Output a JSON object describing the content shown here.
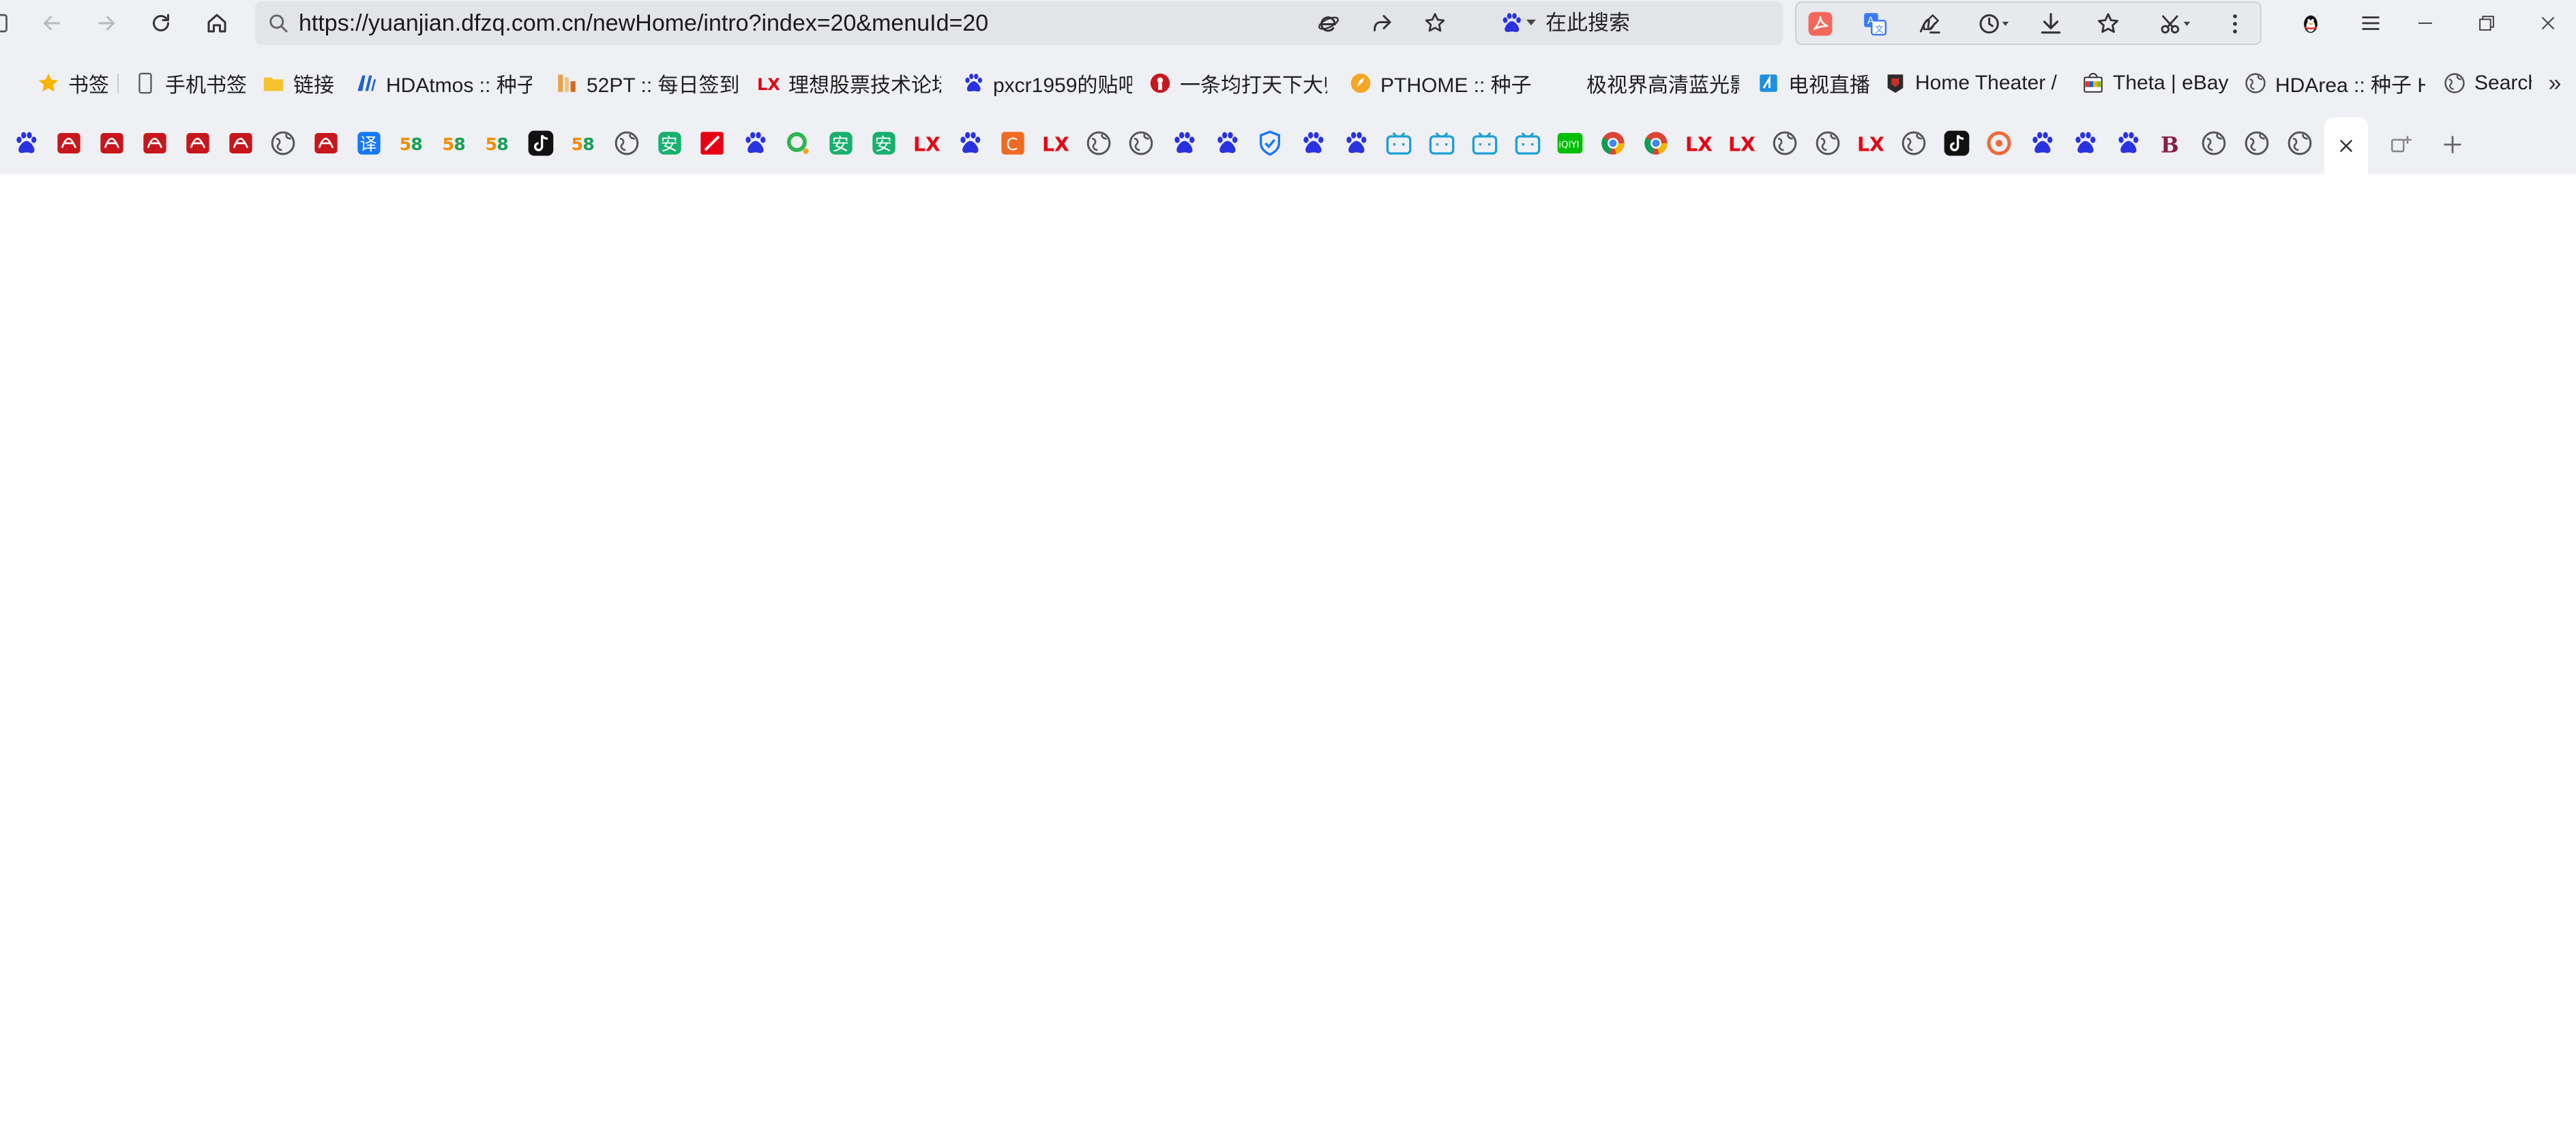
{
  "address_bar": {
    "url": "https://yuanjian.dfzq.com.cn/newHome/intro?index=20&menuId=20",
    "search_engine_label": "在此搜索"
  },
  "bookmarks": [
    {
      "label": "书签",
      "icon": "star-icon"
    },
    {
      "label": "手机书签",
      "icon": "phone-icon"
    },
    {
      "label": "链接",
      "icon": "folder-icon"
    },
    {
      "label": "HDAtmos :: 种子",
      "icon": "hd-site-icon"
    },
    {
      "label": "52PT :: 每日签到 -",
      "icon": "pt-site-icon"
    },
    {
      "label": "理想股票技术论坛",
      "icon": "lx-icon"
    },
    {
      "label": "pxcr1959的贴吧",
      "icon": "baidu-paw-icon"
    },
    {
      "label": "一条均打天下大师",
      "icon": "red-circle-icon"
    },
    {
      "label": "PTHOME :: 种子",
      "icon": "rocket-icon"
    },
    {
      "label": "极视界高清蓝光影",
      "icon": "blank-icon"
    },
    {
      "label": "电视直播",
      "icon": "tv-icon"
    },
    {
      "label": "Home Theater /",
      "icon": "theater-icon"
    },
    {
      "label": "Theta | eBay",
      "icon": "ebay-icon"
    },
    {
      "label": "HDArea :: 种子 H",
      "icon": "globe-icon"
    },
    {
      "label": "Search",
      "icon": "globe-icon"
    }
  ],
  "bookmarks_overflow_label": "»",
  "tabs": [
    "baidu-paw-icon",
    "red-logo-icon",
    "red-logo-icon",
    "red-logo-icon",
    "red-logo-icon",
    "red-logo-icon",
    "globe-icon",
    "red-logo-icon",
    "translate-icon",
    "58-icon",
    "58-icon",
    "58-icon",
    "tiktok-icon",
    "58-icon",
    "globe-icon",
    "green-an-icon",
    "red-square-icon",
    "baidu-paw-icon",
    "green-o-icon",
    "green-an-icon",
    "green-an-icon",
    "lx-icon",
    "baidu-paw-icon",
    "orange-c-icon",
    "lx-icon",
    "globe-icon",
    "globe-icon",
    "baidu-paw-icon",
    "baidu-paw-icon",
    "shield-icon",
    "baidu-paw-icon",
    "baidu-paw-icon",
    "bilibili-icon",
    "bilibili-icon",
    "bilibili-icon",
    "bilibili-icon",
    "iqiyi-icon",
    "chrome-icon",
    "chrome-icon",
    "lx-icon",
    "lx-icon",
    "globe-icon",
    "globe-icon",
    "lx-icon",
    "globe-icon",
    "tiktok-icon",
    "orange-ring-icon",
    "baidu-paw-icon",
    "baidu-paw-icon",
    "baidu-paw-icon",
    "maroon-b-icon",
    "globe-icon",
    "globe-icon",
    "globe-icon"
  ],
  "tab_active_icon": "close-icon",
  "tab_tools": [
    "tab-manager-icon",
    "new-tab-plus-icon"
  ],
  "colors": {
    "chrome_bg": "#eff0f3",
    "url_bg": "#e3e4e8",
    "baidu_blue": "#2932e1",
    "lx_red": "#e60012",
    "green": "#16b06f",
    "bilibili": "#1ea0d5"
  }
}
